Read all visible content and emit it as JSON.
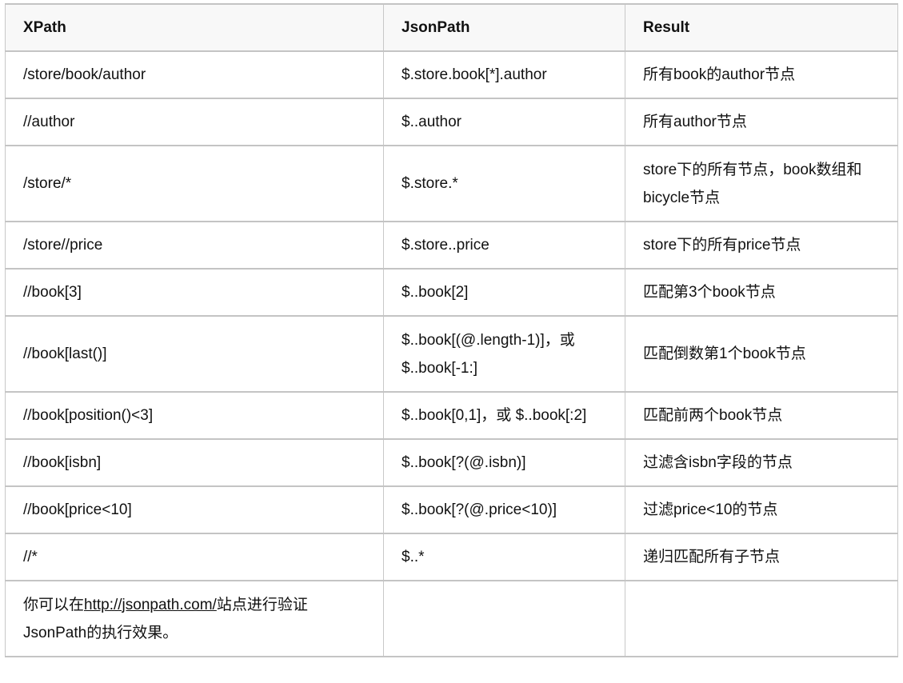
{
  "headers": [
    "XPath",
    "JsonPath",
    "Result"
  ],
  "rows": [
    [
      "/store/book/author",
      "$.store.book[*].author",
      "所有book的author节点"
    ],
    [
      "//author",
      "$..author",
      "所有author节点"
    ],
    [
      "/store/*",
      "$.store.*",
      "store下的所有节点，book数组和bicycle节点"
    ],
    [
      "/store//price",
      "$.store..price",
      "store下的所有price节点"
    ],
    [
      "//book[3]",
      "$..book[2]",
      "匹配第3个book节点"
    ],
    [
      "//book[last()]",
      "$..book[(@.length-1)]，或 $..book[-1:]",
      "匹配倒数第1个book节点"
    ],
    [
      "//book[position()<3]",
      "$..book[0,1]，或 $..book[:2]",
      "匹配前两个book节点"
    ],
    [
      "//book[isbn]",
      "$..book[?(@.isbn)]",
      "过滤含isbn字段的节点"
    ],
    [
      "//book[price<10]",
      "$..book[?(@.price<10)]",
      "过滤price<10的节点"
    ],
    [
      "//*",
      "$..*",
      "递归匹配所有子节点"
    ]
  ],
  "footer": {
    "prefix": "你可以在",
    "link": "http://jsonpath.com/",
    "suffix": "站点进行验证JsonPath的执行效果。"
  }
}
